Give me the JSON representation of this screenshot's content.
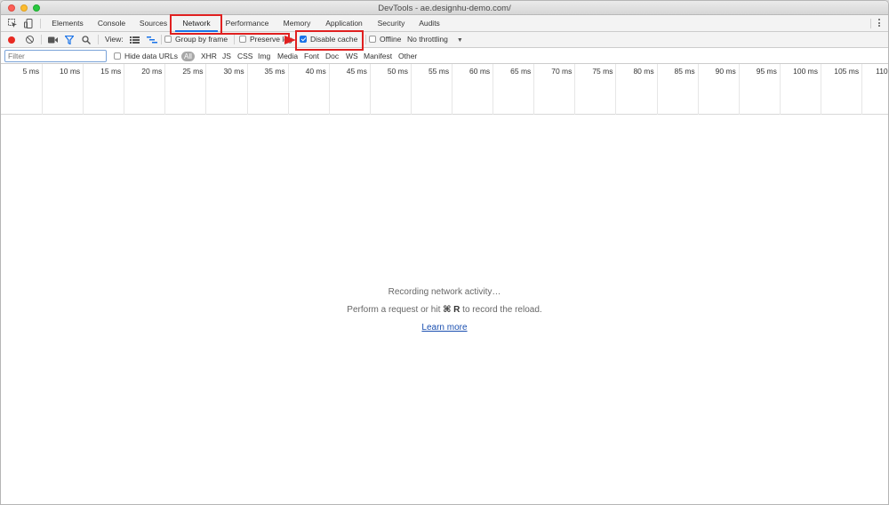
{
  "window": {
    "title": "DevTools - ae.designhu-demo.com/"
  },
  "tabs": [
    {
      "label": "Elements"
    },
    {
      "label": "Console"
    },
    {
      "label": "Sources"
    },
    {
      "label": "Network",
      "active": true
    },
    {
      "label": "Performance"
    },
    {
      "label": "Memory"
    },
    {
      "label": "Application"
    },
    {
      "label": "Security"
    },
    {
      "label": "Audits"
    }
  ],
  "toolbar": {
    "view_label": "View:",
    "group_by_frame": {
      "label": "Group by frame",
      "checked": false
    },
    "preserve_log": {
      "label": "Preserve log",
      "checked": false
    },
    "disable_cache": {
      "label": "Disable cache",
      "checked": true
    },
    "offline": {
      "label": "Offline",
      "checked": false
    },
    "throttling": {
      "value": "No throttling"
    }
  },
  "filter": {
    "placeholder": "Filter",
    "hide_data_urls": {
      "label": "Hide data URLs",
      "checked": false
    },
    "types": [
      "All",
      "XHR",
      "JS",
      "CSS",
      "Img",
      "Media",
      "Font",
      "Doc",
      "WS",
      "Manifest",
      "Other"
    ]
  },
  "timeline": {
    "ticks": [
      "5 ms",
      "10 ms",
      "15 ms",
      "20 ms",
      "25 ms",
      "30 ms",
      "35 ms",
      "40 ms",
      "45 ms",
      "50 ms",
      "55 ms",
      "60 ms",
      "65 ms",
      "70 ms",
      "75 ms",
      "80 ms",
      "85 ms",
      "90 ms",
      "95 ms",
      "100 ms",
      "105 ms",
      "110"
    ]
  },
  "empty_state": {
    "line1": "Recording network activity…",
    "line2_pre": "Perform a request or hit ",
    "line2_key": "⌘ R",
    "line2_post": " to record the reload.",
    "learn_more": "Learn more"
  },
  "colors": {
    "record": "#e82a22",
    "accent": "#1a73e8",
    "annotation": "#e02020"
  }
}
